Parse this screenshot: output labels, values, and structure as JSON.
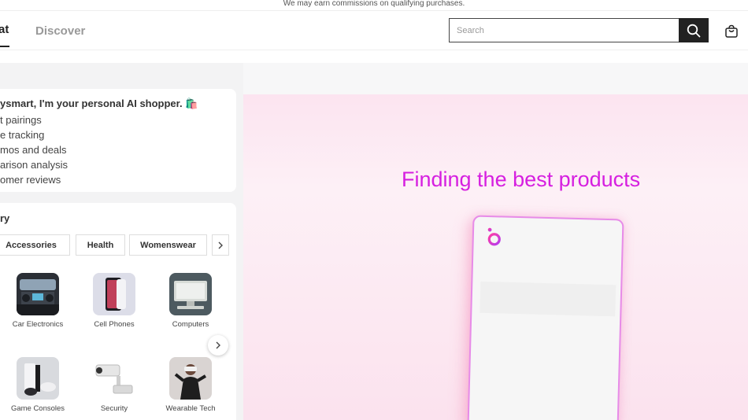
{
  "banner": {
    "text": "We may earn commissions on qualifying purchases."
  },
  "header": {
    "nav": {
      "chat": "at",
      "discover": "Discover"
    },
    "search": {
      "placeholder": "Search"
    },
    "icons": {
      "search": "search-icon",
      "cart": "shopping-bag-icon"
    }
  },
  "intro": {
    "title": "ysmart, I'm your personal AI shopper. 🛍️",
    "items": [
      "t pairings",
      "e tracking",
      "mos and deals",
      "arison analysis",
      "omer reviews"
    ]
  },
  "categories": {
    "title": "ry",
    "chips": [
      "Accessories",
      "Health",
      "Womenswear"
    ],
    "items": [
      {
        "label": "Car Electronics",
        "icon": "car-electronics-icon"
      },
      {
        "label": "Cell Phones",
        "icon": "cell-phone-icon"
      },
      {
        "label": "Computers",
        "icon": "computer-icon"
      },
      {
        "label": "Game Consoles",
        "icon": "game-console-icon"
      },
      {
        "label": "Security",
        "icon": "security-camera-icon"
      },
      {
        "label": "Wearable Tech",
        "icon": "vr-headset-icon"
      }
    ]
  },
  "main": {
    "title": "Finding the best products"
  },
  "colors": {
    "accent": "#d61fe0",
    "dark": "#222222",
    "panel": "#f3f3f4"
  }
}
